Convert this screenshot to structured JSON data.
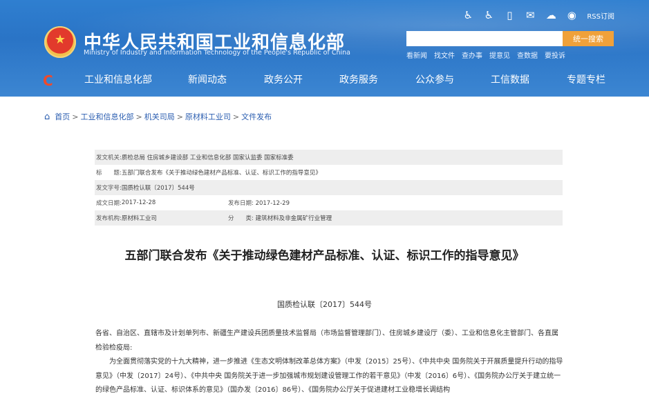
{
  "header": {
    "title": "中华人民共和国工业和信息化部",
    "subtitle": "Ministry of Industry and Information Technology of the People's Republic of China",
    "rss_label": "RSS订阅",
    "search": {
      "placeholder": "",
      "button_label": "统一搜索"
    },
    "quick_links": [
      "看新闻",
      "找文件",
      "查办事",
      "提意见",
      "查数据",
      "要投诉"
    ],
    "icons": [
      "accessibility-icon",
      "wheelchair-icon",
      "mobile-icon",
      "mail-icon",
      "wechat-icon",
      "weibo-icon"
    ]
  },
  "nav": {
    "items": [
      "工业和信息化部",
      "新闻动态",
      "政务公开",
      "政务服务",
      "公众参与",
      "工信数据",
      "专题专栏"
    ]
  },
  "breadcrumb": [
    "首页",
    "工业和信息化部",
    "机关司局",
    "原材料工业司",
    "文件发布"
  ],
  "meta": {
    "issuer_label": "发文机关:",
    "issuer": "质检总局 住房城乡建设部 工业和信息化部 国家认监委 国家标准委",
    "title_label": "标　　题:",
    "title": "五部门联合发布《关于推动绿色建材产品标准、认证、标识工作的指导意见》",
    "docno_label": "发文字号:",
    "docno": "国质检认联〔2017〕544号",
    "written_label": "成文日期:",
    "written": "2017-12-28",
    "published_label": "发布日期:",
    "published": "2017-12-29",
    "org_label": "发布机构:",
    "org": "原材料工业司",
    "category_label": "分　　类:",
    "category": "建筑材料及非金属矿行业管理"
  },
  "document": {
    "title": "五部门联合发布《关于推动绿色建材产品标准、认证、标识工作的指导意见》",
    "number": "国质检认联〔2017〕544号",
    "para1": "各省、自治区、直辖市及计划单列市、新疆生产建设兵团质量技术监督局（市场监督管理部门）、住房城乡建设厅（委）、工业和信息化主管部门、各直属检验检疫局:",
    "para2": "为全面贯彻落实党的十九大精神，进一步推进《生态文明体制改革总体方案》（中发〔2015〕25号）、《中共中央 国务院关于开展质量提升行动的指导意见》（中发〔2017〕24号）、《中共中央 国务院关于进一步加强城市规划建设管理工作的若干意见》（中发〔2016〕6号）、《国务院办公厅关于建立统一的绿色产品标准、认证、标识体系的意见》（国办发〔2016〕86号）、《国务院办公厅关于促进建材工业稳增长调结构"
  }
}
